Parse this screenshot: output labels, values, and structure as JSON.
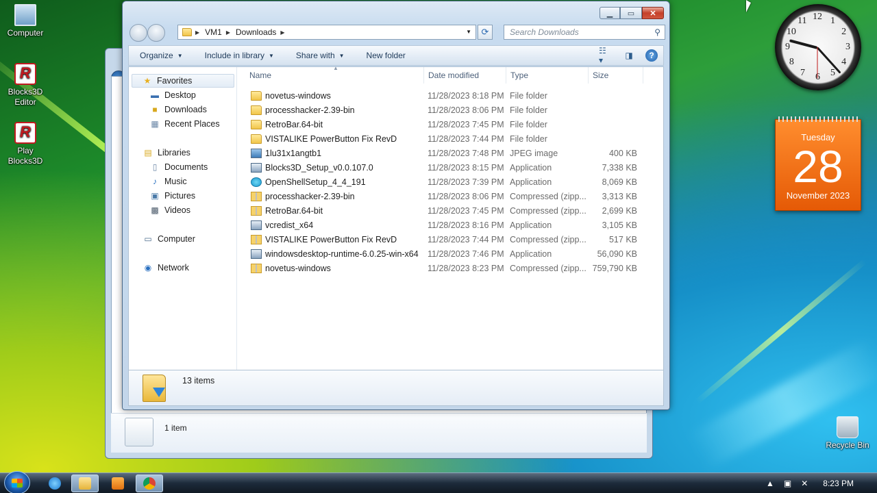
{
  "desktop": {
    "icons": [
      {
        "label": "Computer"
      },
      {
        "label": "Blocks3D Editor"
      },
      {
        "label": "Play Blocks3D"
      },
      {
        "label": "Recycle Bin"
      }
    ]
  },
  "back_window": {
    "status_text": "1 item"
  },
  "explorer": {
    "address": {
      "parts": [
        "VM1",
        "Downloads"
      ]
    },
    "search_placeholder": "Search Downloads",
    "toolbar": {
      "organize": "Organize",
      "include_in_library": "Include in library",
      "share_with": "Share with",
      "new_folder": "New folder"
    },
    "nav": {
      "favorites": "Favorites",
      "desktop": "Desktop",
      "downloads": "Downloads",
      "recent_places": "Recent Places",
      "libraries": "Libraries",
      "documents": "Documents",
      "music": "Music",
      "pictures": "Pictures",
      "videos": "Videos",
      "computer": "Computer",
      "network": "Network"
    },
    "columns": {
      "name": "Name",
      "date": "Date modified",
      "type": "Type",
      "size": "Size"
    },
    "files": [
      {
        "name": "novetus-windows",
        "date": "11/28/2023 8:18 PM",
        "type": "File folder",
        "size": "",
        "icon": "folder"
      },
      {
        "name": "processhacker-2.39-bin",
        "date": "11/28/2023 8:06 PM",
        "type": "File folder",
        "size": "",
        "icon": "folder"
      },
      {
        "name": "RetroBar.64-bit",
        "date": "11/28/2023 7:45 PM",
        "type": "File folder",
        "size": "",
        "icon": "folder"
      },
      {
        "name": "VISTALIKE PowerButton Fix RevD",
        "date": "11/28/2023 7:44 PM",
        "type": "File folder",
        "size": "",
        "icon": "folder"
      },
      {
        "name": "1lu31x1angtb1",
        "date": "11/28/2023 7:48 PM",
        "type": "JPEG image",
        "size": "400 KB",
        "icon": "jpg"
      },
      {
        "name": "Blocks3D_Setup_v0.0.107.0",
        "date": "11/28/2023 8:15 PM",
        "type": "Application",
        "size": "7,338 KB",
        "icon": "app"
      },
      {
        "name": "OpenShellSetup_4_4_191",
        "date": "11/28/2023 7:39 PM",
        "type": "Application",
        "size": "8,069 KB",
        "icon": "shell"
      },
      {
        "name": "processhacker-2.39-bin",
        "date": "11/28/2023 8:06 PM",
        "type": "Compressed (zipp...",
        "size": "3,313 KB",
        "icon": "zip"
      },
      {
        "name": "RetroBar.64-bit",
        "date": "11/28/2023 7:45 PM",
        "type": "Compressed (zipp...",
        "size": "2,699 KB",
        "icon": "zip"
      },
      {
        "name": "vcredist_x64",
        "date": "11/28/2023 8:16 PM",
        "type": "Application",
        "size": "3,105 KB",
        "icon": "app"
      },
      {
        "name": "VISTALIKE PowerButton Fix RevD",
        "date": "11/28/2023 7:44 PM",
        "type": "Compressed (zipp...",
        "size": "517 KB",
        "icon": "zip"
      },
      {
        "name": "windowsdesktop-runtime-6.0.25-win-x64",
        "date": "11/28/2023 7:46 PM",
        "type": "Application",
        "size": "56,090 KB",
        "icon": "app"
      },
      {
        "name": "novetus-windows",
        "date": "11/28/2023 8:23 PM",
        "type": "Compressed (zipp...",
        "size": "759,790 KB",
        "icon": "zip"
      }
    ],
    "status_text": "13 items"
  },
  "calendar": {
    "weekday": "Tuesday",
    "day": "28",
    "month_year": "November 2023"
  },
  "clock": {
    "numbers": [
      "12",
      "1",
      "2",
      "3",
      "4",
      "5",
      "6",
      "7",
      "8",
      "9",
      "10",
      "11"
    ],
    "time": "8:23 PM"
  },
  "taskbar": {
    "time": "8:23 PM"
  },
  "colors": {
    "accent": "#1e3a5a",
    "calendar": "#e55a06"
  }
}
